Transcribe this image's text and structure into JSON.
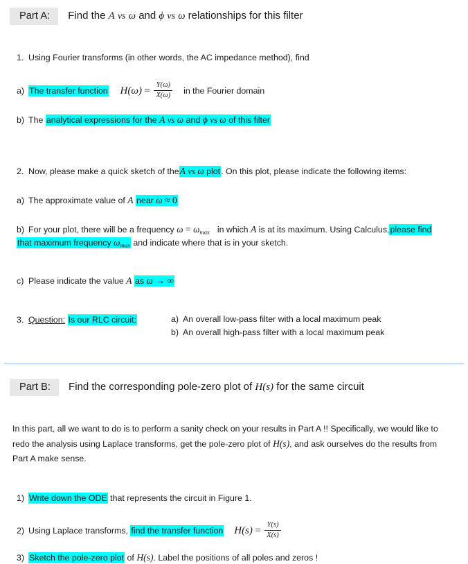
{
  "document": {
    "title": "Filter analysis assignment — Part A and Part B",
    "background_color": "#ffffff",
    "highlight_color": "#00ffff",
    "tag_background_color": "#e7e7e7",
    "divider_color": "#9cb8dd"
  },
  "part_a": {
    "tag": "Part A:",
    "title_pre": "Find the",
    "title_A": "A",
    "title_vs1": "vs",
    "title_w1": "ω",
    "title_and": "and",
    "title_phi": "ϕ",
    "title_vs2": "vs",
    "title_w2": "ω",
    "title_post": "relationships for this filter",
    "item1": {
      "marker": "1.",
      "text": "Using Fourier transforms  (in other words, the AC impedance method), find"
    },
    "item1a": {
      "marker": "a)",
      "highlight": "The transfer function",
      "formula_H": "H(ω)",
      "formula_eq": "=",
      "frac_num": "Y(ω)",
      "frac_den": "X(ω)",
      "tail": "in the Fourier domain"
    },
    "item1b": {
      "marker": "b)",
      "lead": "The",
      "highlight_start": "analytical expressions for the",
      "A": "A",
      "vs1": "vs",
      "w1": "ω",
      "and": "and",
      "phi": "ϕ",
      "vs2": "vs",
      "w2": "ω",
      "highlight_end": "of this filter"
    },
    "item2": {
      "marker": "2.",
      "lead": "Now, please make a quick sketch of the",
      "hl_A": "A",
      "hl_vs": "vs",
      "hl_w": "ω",
      "hl_plot": "plot",
      "tail": ".  On this plot, please indicate the following items:"
    },
    "item2a": {
      "marker": "a)",
      "lead": "The approximate value of",
      "A": "A",
      "hl_near": "near",
      "hl_w": "ω",
      "hl_approx": "≈",
      "hl_zero": "0"
    },
    "item2b": {
      "marker": "b)",
      "line1_lead": "For your plot, there will be a frequency",
      "line1_w": "ω",
      "line1_eq": "=",
      "line1_wmax": "ω",
      "line1_wmax_sub": "max",
      "line1_mid": "in which",
      "line1_A": "A",
      "line1_tail": "is at its maximum. Using Calculus,",
      "line1_hl": "please find",
      "line2_hl_lead": "that maximum frequency",
      "line2_hl_wmax": "ω",
      "line2_hl_wmax_sub": "max",
      "line2_tail": "and indicate where that is in your sketch."
    },
    "item2c": {
      "marker": "c)",
      "lead": "Please indicate the value",
      "A": "A",
      "hl_as": "as",
      "hl_w": "ω",
      "hl_arrow": "→",
      "hl_inf": "∞"
    },
    "item3": {
      "marker": "3.",
      "label": "Question:",
      "highlight": "Is our RLC circuit:",
      "choices": [
        {
          "marker": "a)",
          "text": "An overall low-pass filter with a  local maximum peak"
        },
        {
          "marker": "b)",
          "text": "An overall high-pass filter with a local maximum peak"
        }
      ]
    }
  },
  "part_b": {
    "tag": "Part B:",
    "title_pre": "Find the corresponding pole-zero plot of",
    "title_H": "H(s)",
    "title_post": "for the same circuit",
    "intro_line1": "In this part, all we want to do is to perform a sanity check on your results in Part A !!  Specifically, we would like to",
    "intro_line2_pre": "redo the analysis using Laplace transforms, get the pole-zero plot of",
    "intro_line2_H": "H(s)",
    "intro_line2_post": ", and ask ourselves do the results from",
    "intro_line3": "Part A make sense.",
    "item1": {
      "marker": "1)",
      "highlight": "Write down the ODE",
      "tail": "that represents the circuit in Figure 1."
    },
    "item2": {
      "marker": "2)",
      "lead": "Using Laplace transforms,",
      "highlight": "find the transfer function",
      "formula_H": "H(s)",
      "formula_eq": "=",
      "frac_num": "Y(s)",
      "frac_den": "X(s)"
    },
    "item3": {
      "marker": "3)",
      "highlight": "Sketch the pole-zero plot",
      "mid": "of",
      "H": "H(s)",
      "tail": ".  Label the positions of all poles and zeros !"
    }
  }
}
